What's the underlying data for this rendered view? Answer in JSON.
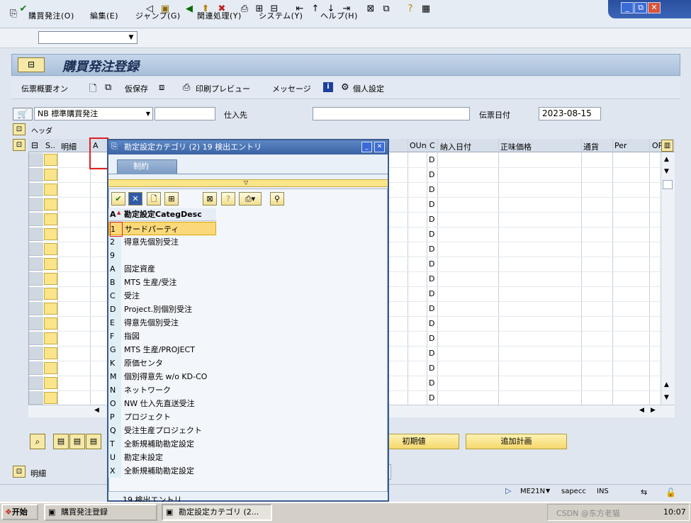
{
  "menu": {
    "items": [
      "購買発注(O)",
      "編集(E)",
      "ジャンプ(G)",
      "関連処理(Y)",
      "システム(Y)",
      "ヘルプ(H)"
    ]
  },
  "window_controls": {
    "minimize": "_",
    "restore": "⧉",
    "close": "✕"
  },
  "toolbar": {
    "command_value": ""
  },
  "page": {
    "title": "購買発注登録"
  },
  "app_toolbar": {
    "doc_overview": "伝票概要オン",
    "hold": "仮保存",
    "print_preview": "印刷プレビュー",
    "messages": "メッセージ",
    "personal_settings": "個人設定"
  },
  "header": {
    "doc_type": "NB 標準購買発注",
    "vendor_label": "仕入先",
    "vendor_value": "",
    "doc_date_label": "伝票日付",
    "doc_date_value": "2023-08-15",
    "header_label": "ヘッダ",
    "detail_label": "明細"
  },
  "item_table": {
    "columns": [
      "S..",
      "明細",
      "A",
      "OUn",
      "C",
      "納入日付",
      "正味価格",
      "通貨",
      "Per",
      "OP"
    ],
    "c_values": [
      "D",
      "D",
      "D",
      "D",
      "D",
      "D",
      "D",
      "D",
      "D",
      "D",
      "D",
      "D",
      "D",
      "D",
      "D",
      "D",
      "D"
    ]
  },
  "buttons": {
    "initial_values": "初期値",
    "add_planning": "追加計画"
  },
  "dialog": {
    "title": "勘定設定カテゴリ (2)   19 検出エントリ",
    "tab": "制約",
    "col_code": "A",
    "col_desc": "勘定設定CategDesc",
    "rows": [
      {
        "code": "1",
        "desc": "サードパーティ"
      },
      {
        "code": "2",
        "desc": "得意先個別受注"
      },
      {
        "code": "9",
        "desc": ""
      },
      {
        "code": "A",
        "desc": "固定資産"
      },
      {
        "code": "B",
        "desc": "MTS 生産/受注"
      },
      {
        "code": "C",
        "desc": "受注"
      },
      {
        "code": "D",
        "desc": "Project.別個別受注"
      },
      {
        "code": "E",
        "desc": "得意先個別受注"
      },
      {
        "code": "F",
        "desc": "指図"
      },
      {
        "code": "G",
        "desc": "MTS 生産/PROJECT"
      },
      {
        "code": "K",
        "desc": "原価センタ"
      },
      {
        "code": "M",
        "desc": "個別得意先 w/o KD-CO"
      },
      {
        "code": "N",
        "desc": "ネットワーク"
      },
      {
        "code": "O",
        "desc": "NW 仕入先直送受注"
      },
      {
        "code": "P",
        "desc": "プロジェクト"
      },
      {
        "code": "Q",
        "desc": "受注生産プロジェクト"
      },
      {
        "code": "T",
        "desc": "全新規補助勘定設定"
      },
      {
        "code": "U",
        "desc": "勘定未設定"
      },
      {
        "code": "X",
        "desc": "全新規補助勘定設定"
      }
    ],
    "status": "19 検出エントリ"
  },
  "statusbar": {
    "tcode": "ME21N",
    "server": "sapecc",
    "mode": "INS"
  },
  "taskbar": {
    "start": "开始",
    "task1": "購買発注登録",
    "task2": "勘定設定カテゴリ (2...",
    "clock": "10:07",
    "watermark": "CSDN @东方老猫"
  },
  "colors": {
    "accent": "#3a63a4",
    "highlight": "#fbd97a",
    "field_yellow": "#fbe58a",
    "annotation": "#e02020"
  }
}
